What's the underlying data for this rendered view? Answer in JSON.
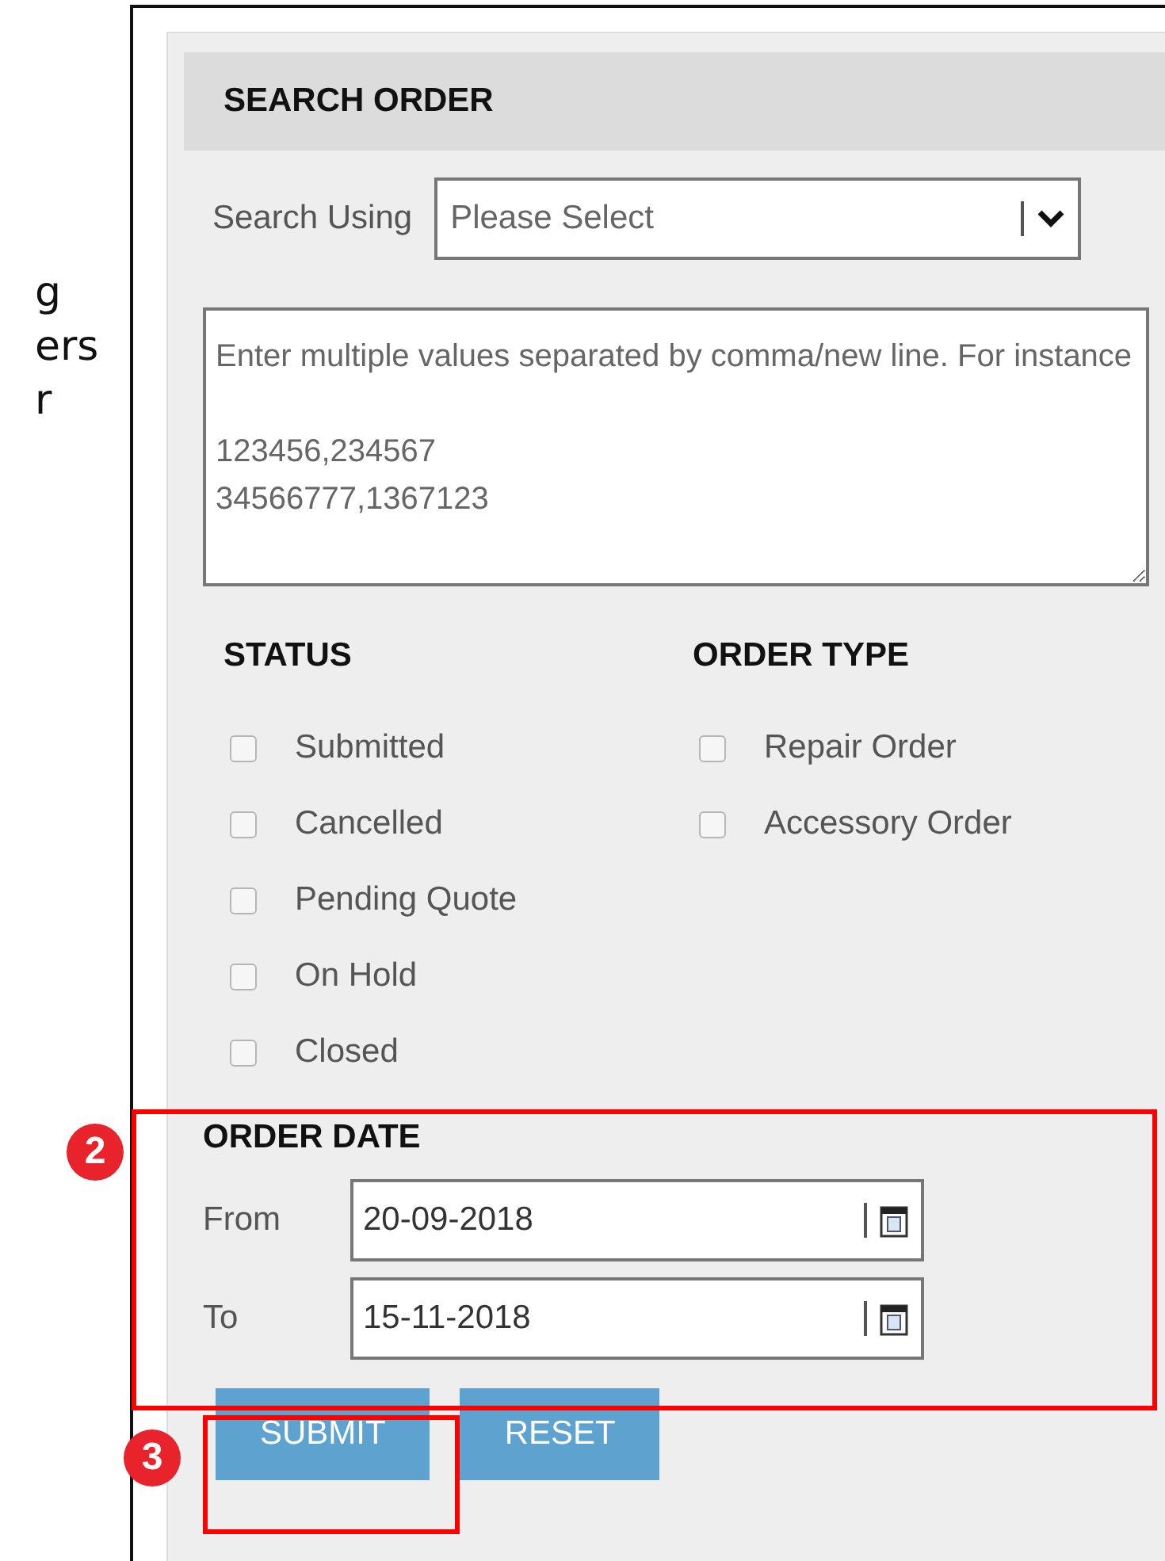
{
  "side_text": [
    "g",
    "ers",
    "r"
  ],
  "panel": {
    "title": "SEARCH ORDER",
    "search_using": {
      "label": "Search Using",
      "value": "Please Select"
    },
    "values_box": {
      "placeholder": "Enter multiple values separated by comma/new line. For instance\n\n123456,234567\n34566777,1367123"
    },
    "status": {
      "heading": "STATUS",
      "options": [
        {
          "label": "Submitted",
          "checked": false
        },
        {
          "label": "Cancelled",
          "checked": false
        },
        {
          "label": "Pending Quote",
          "checked": false
        },
        {
          "label": "On Hold",
          "checked": false
        },
        {
          "label": "Closed",
          "checked": false
        }
      ]
    },
    "order_type": {
      "heading": "ORDER TYPE",
      "options": [
        {
          "label": "Repair Order",
          "checked": false
        },
        {
          "label": "Accessory Order",
          "checked": false
        }
      ]
    },
    "order_date": {
      "heading": "ORDER DATE",
      "from": {
        "label": "From",
        "value": "20-09-2018"
      },
      "to": {
        "label": "To",
        "value": "15-11-2018"
      }
    },
    "buttons": [
      {
        "label": "SUBMIT"
      },
      {
        "label": "RESET"
      }
    ]
  },
  "annotations": [
    {
      "number": "2"
    },
    {
      "number": "3"
    }
  ]
}
